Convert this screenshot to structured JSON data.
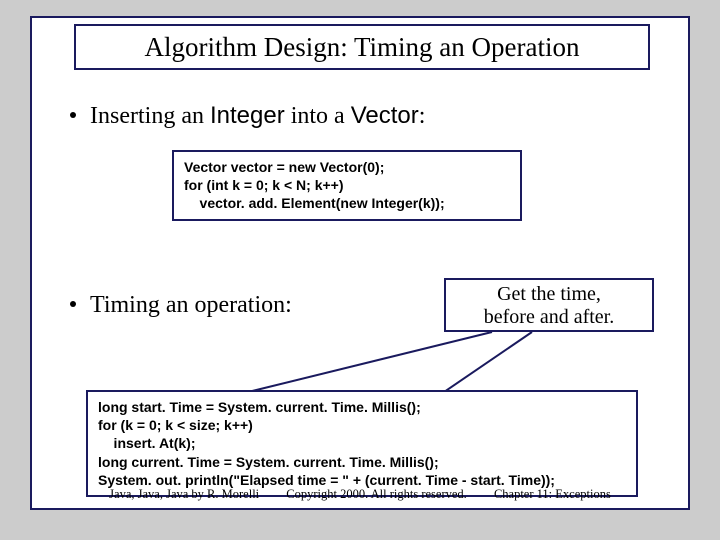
{
  "title": "Algorithm Design: Timing an Operation",
  "bullets": {
    "first": {
      "pre": "Inserting an ",
      "code": "Integer",
      "mid": " into a ",
      "code2": "Vector",
      "post": ":"
    },
    "second": "Timing an operation:"
  },
  "code1": "Vector vector = new Vector(0);\nfor (int k = 0; k < N; k++)\n    vector. add. Element(new Integer(k));",
  "code2": "long start. Time = System. current. Time. Millis();\nfor (k = 0; k < size; k++)\n    insert. At(k);\nlong current. Time = System. current. Time. Millis();\nSystem. out. println(\"Elapsed time = \" + (current. Time - start. Time));",
  "callout": {
    "line1": "Get the time,",
    "line2": "before and after."
  },
  "footer": {
    "left": "Java, Java, Java by R. Morelli",
    "center": "Copyright 2000. All rights reserved.",
    "right": "Chapter 11: Exceptions"
  }
}
